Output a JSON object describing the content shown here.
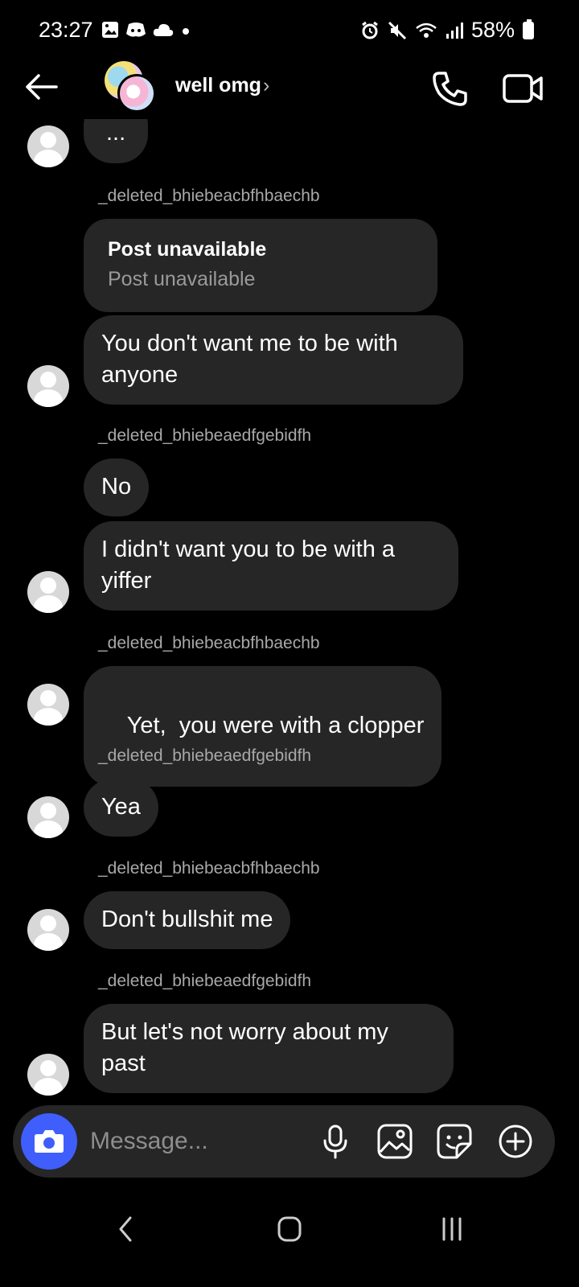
{
  "status_bar": {
    "time": "23:27",
    "battery": "58%"
  },
  "header": {
    "title": "well omg",
    "title_chevron": "›"
  },
  "post": {
    "sender": "_deleted_bhiebeacbfhbaechb",
    "title": "Post unavailable",
    "subtitle": "Post unavailable"
  },
  "messages": [
    {
      "sender": "",
      "text": "..."
    },
    {
      "sender": "",
      "text": "You don't want me to be with anyone"
    },
    {
      "sender": "_deleted_bhiebeaedfgebidfh",
      "text": "No"
    },
    {
      "sender": "",
      "text": "I didn't want you to be with a yiffer"
    },
    {
      "sender": "_deleted_bhiebeacbfhbaechb",
      "text": "Yet,  you were with a clopper"
    },
    {
      "sender": "_deleted_bhiebeaedfgebidfh",
      "text": "Yea"
    },
    {
      "sender": "_deleted_bhiebeacbfhbaechb",
      "text": "Don't bullshit me"
    },
    {
      "sender": "_deleted_bhiebeaedfgebidfh",
      "text": "But let's not worry about my past"
    }
  ],
  "composer": {
    "placeholder": "Message..."
  },
  "icons": {
    "back": "arrow-left",
    "call": "phone",
    "video": "video-camera",
    "camera": "camera",
    "mic": "microphone",
    "gallery": "image",
    "sticker": "sticker",
    "more": "plus-circle"
  },
  "colors": {
    "background": "#000000",
    "bubble": "#262626",
    "camera_button": "#3f5efb",
    "secondary_text": "#a8a8a8"
  }
}
